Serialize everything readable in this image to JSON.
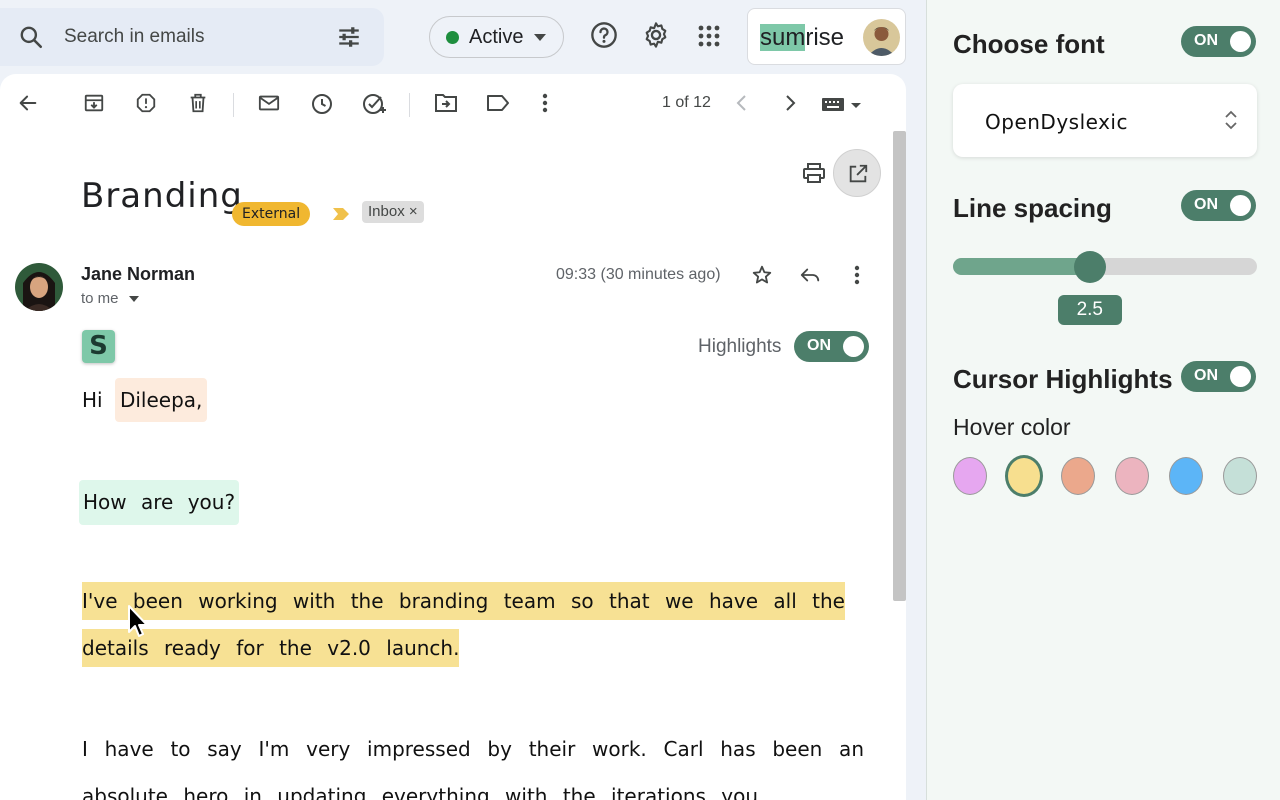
{
  "search": {
    "placeholder": "Search in emails"
  },
  "status": {
    "label": "Active"
  },
  "brand": {
    "prefix": "sum",
    "suffix": "rise"
  },
  "toolbar": {
    "pager": "1 of 12"
  },
  "email": {
    "subject": "Branding",
    "labels": [
      "External",
      "Inbox"
    ],
    "inbox_remove": "×",
    "sender": "Jane Norman",
    "to": "to me",
    "time": "09:33 (30 minutes ago)",
    "badge_letter": "S",
    "highlights_label": "Highlights",
    "highlights_toggle": "ON",
    "greeting": "Hi",
    "greeting_name": "Dileepa,",
    "question": "How are you?",
    "para1_line1": "I've been working with the branding team so that we have all the",
    "para1_line2": "details ready for the v2.0 launch.",
    "para2": "I have to say I'm very impressed by their work. Carl has been an absolute hero in updating everything with the iterations you"
  },
  "panel": {
    "font_title": "Choose font",
    "font_toggle": "ON",
    "font_value": "OpenDyslexic",
    "spacing_title": "Line spacing",
    "spacing_toggle": "ON",
    "spacing_value": "2.5",
    "spacing_fraction": 0.45,
    "cursor_title": "Cursor Highlights",
    "cursor_toggle": "ON",
    "hover_label": "Hover color",
    "hover_colors": [
      "#e6a7f0",
      "#f7df8f",
      "#eba88c",
      "#ecb4bf",
      "#5cb5f7",
      "#c5e0d8"
    ],
    "hover_selected": 1
  }
}
